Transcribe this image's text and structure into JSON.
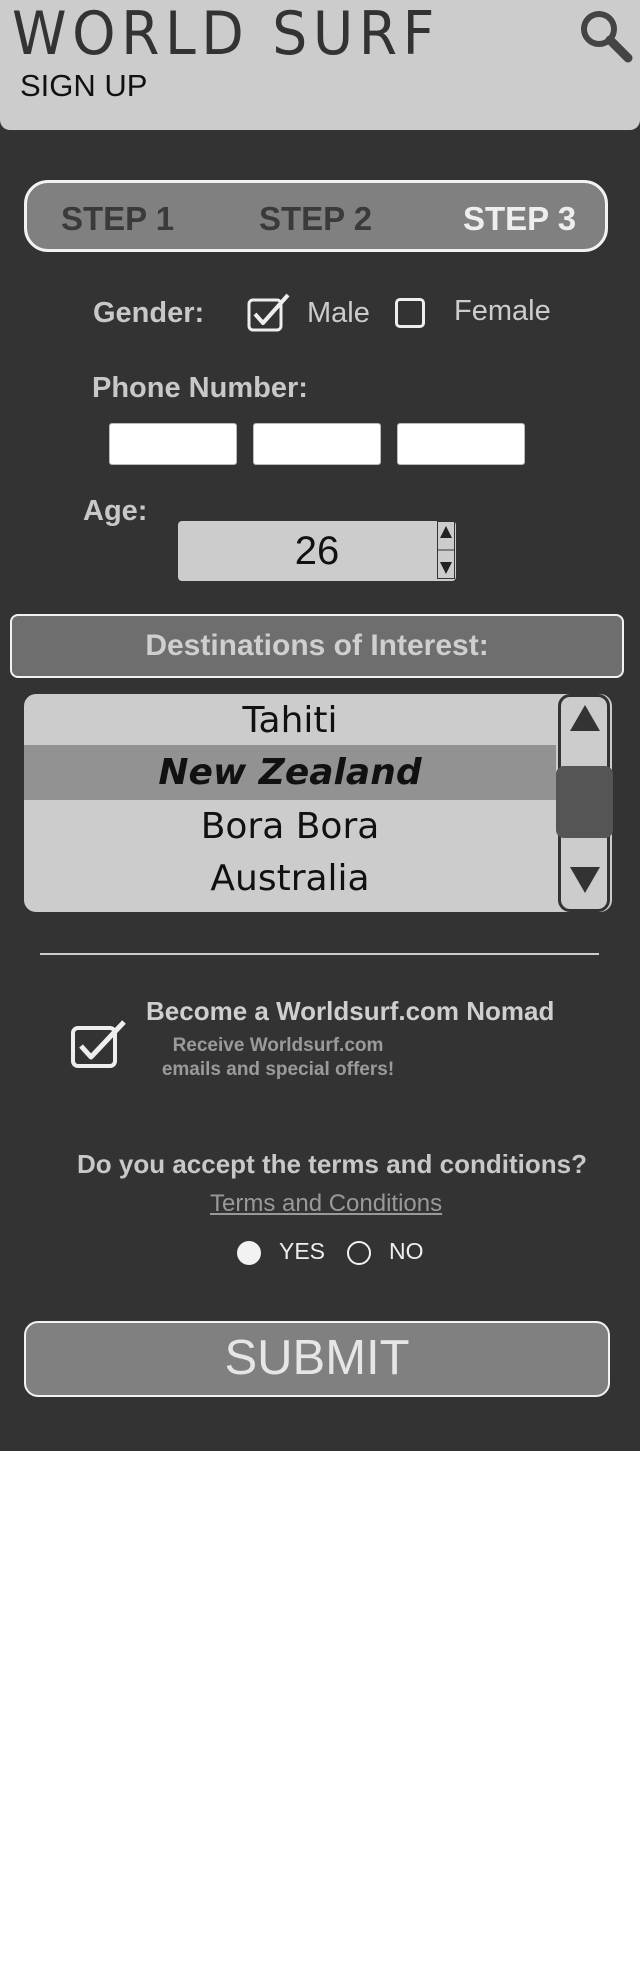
{
  "header": {
    "brand": "WORLD SURF",
    "subtitle": "SIGN UP",
    "search_icon": "search-icon"
  },
  "steps": [
    {
      "label": "STEP 1"
    },
    {
      "label": "STEP 2"
    },
    {
      "label": "STEP 3"
    }
  ],
  "gender": {
    "label": "Gender:",
    "options": [
      {
        "label": "Male",
        "checked": true
      },
      {
        "label": "Female",
        "checked": false
      }
    ]
  },
  "phone": {
    "label": "Phone Number:",
    "fields": [
      "",
      "",
      ""
    ]
  },
  "age": {
    "label": "Age:",
    "value": "26"
  },
  "destinations": {
    "button_label": "Destinations of Interest:",
    "items": [
      {
        "label": "Tahiti",
        "selected": false
      },
      {
        "label": "New Zealand",
        "selected": true
      },
      {
        "label": "Bora Bora",
        "selected": false
      },
      {
        "label": "Australia",
        "selected": false
      }
    ]
  },
  "nomad": {
    "title": "Become a Worldsurf.com Nomad",
    "subtitle": "Receive Worldsurf.com emails and special offers!",
    "checked": true
  },
  "terms": {
    "question": "Do you accept the terms and conditions?",
    "link": "Terms and Conditions",
    "yes_label": "YES",
    "no_label": "NO",
    "selected": "YES"
  },
  "submit_label": "SUBMIT",
  "colors": {
    "background": "#333333",
    "header": "#cccccc",
    "panel": "#808080",
    "text_light": "#cccccc"
  }
}
